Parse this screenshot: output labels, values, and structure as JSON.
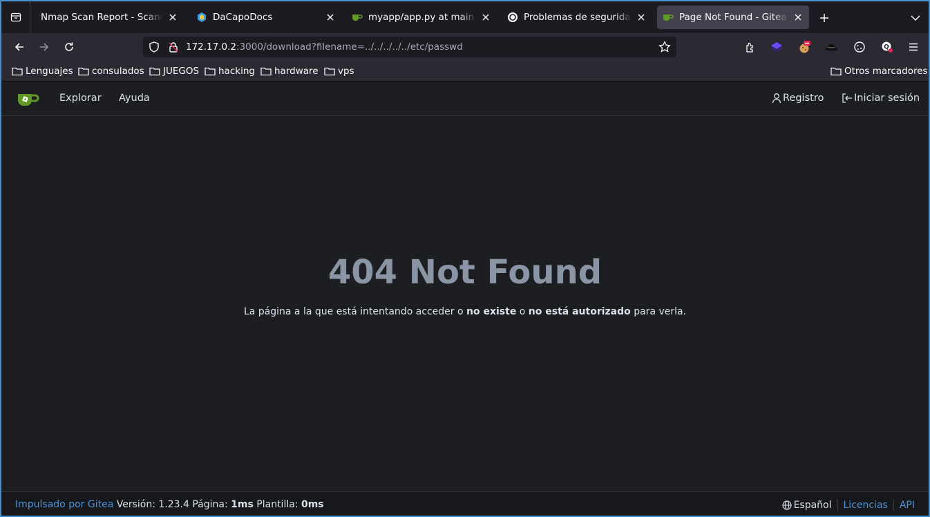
{
  "browser": {
    "tabs": [
      {
        "title": "Nmap Scan Report - Scanned at",
        "active": false
      },
      {
        "title": "DaCapoDocs",
        "active": false
      },
      {
        "title": "myapp/app.py at main - my",
        "active": false
      },
      {
        "title": "Problemas de seguridad Fla",
        "active": false
      },
      {
        "title": "Page Not Found - Gitea: Git",
        "active": true
      }
    ],
    "url_host": "172.17.0.2",
    "url_path": ":3000/download?filename=../../../../../etc/passwd",
    "bookmarks": [
      "Lenguajes",
      "consulados",
      "JUEGOS",
      "hacking",
      "hardware",
      "vps"
    ],
    "other_bookmarks": "Otros marcadores",
    "accent_color": "#4a90c8"
  },
  "gitea": {
    "nav": {
      "explore": "Explorar",
      "help": "Ayuda",
      "register": "Registro",
      "sign_in": "Iniciar sesión"
    },
    "error": {
      "title": "404 Not Found",
      "msg_part1": "La página a la que está intentando acceder o ",
      "msg_bold1": "no existe",
      "msg_part2": " o ",
      "msg_bold2": "no está autorizado",
      "msg_part3": " para verla."
    },
    "footer": {
      "powered_by": "Impulsado por Gitea",
      "version": " Versión: 1.23.4 Página: ",
      "page_time": "1ms",
      "template_label": " Plantilla: ",
      "template_time": "0ms",
      "language": "Español",
      "licenses": "Licencias",
      "api": "API"
    },
    "brand_color": "#609926",
    "link_color": "#4c93d8"
  }
}
